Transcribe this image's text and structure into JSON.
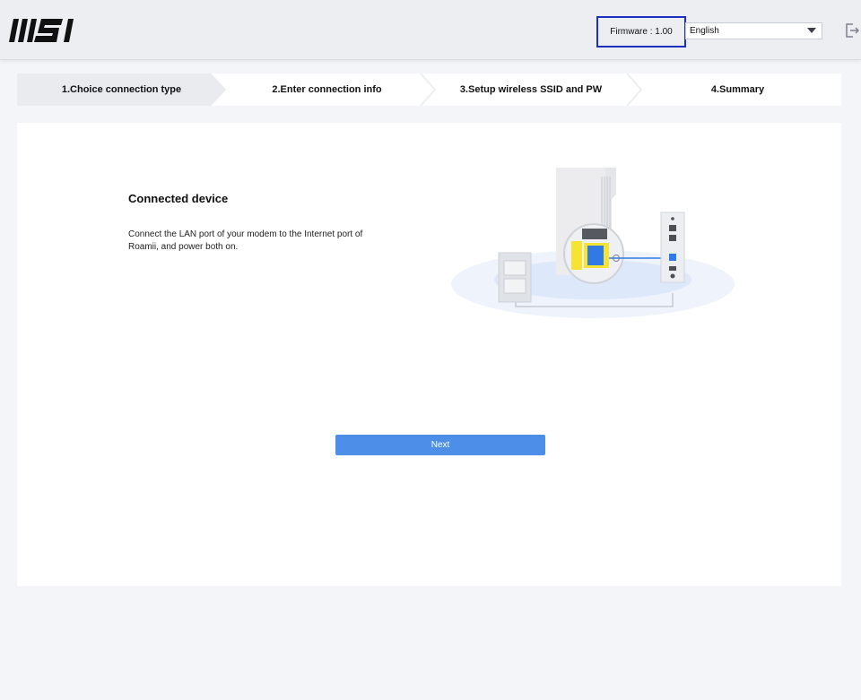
{
  "header": {
    "logo_text": "MSI",
    "firmware_label": "Firmware : 1.00",
    "language": {
      "selected": "English"
    },
    "logout_icon": "logout-icon"
  },
  "steps": [
    {
      "label": "1.Choice connection type",
      "active": true
    },
    {
      "label": "2.Enter connection info",
      "active": false
    },
    {
      "label": "3.Setup wireless SSID and PW",
      "active": false
    },
    {
      "label": "4.Summary",
      "active": false
    }
  ],
  "main": {
    "title": "Connected device",
    "description": "Connect the LAN port of your modem to the Internet port of Roamii, and power both on.",
    "next_button": "Next"
  },
  "colors": {
    "accent": "#4d8fe8",
    "highlight_border": "#1c2fbf",
    "port_yellow": "#f5e532",
    "port_blue": "#2f7ae5"
  }
}
